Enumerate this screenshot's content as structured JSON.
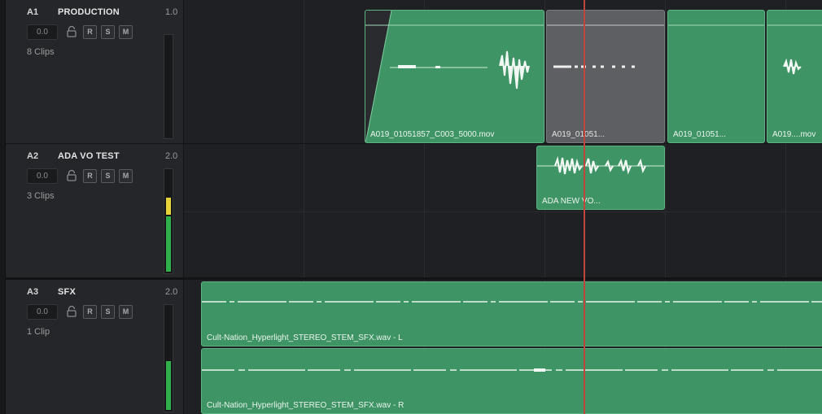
{
  "tracks": [
    {
      "id": "A1",
      "name": "PRODUCTION",
      "level": "1.0",
      "volume": "0.0",
      "clips": "8 Clips"
    },
    {
      "id": "A2",
      "name": "ADA VO TEST",
      "level": "2.0",
      "volume": "0.0",
      "clips": "3 Clips"
    },
    {
      "id": "A3",
      "name": "SFX",
      "level": "2.0",
      "volume": "0.0",
      "clips": "1 Clip"
    }
  ],
  "buttons": {
    "record": "R",
    "solo": "S",
    "mute": "M"
  },
  "clips": {
    "a1": [
      "A019_01051857_C003_5000.mov",
      "A019_01051...",
      "A019_01051...",
      "A019....mov"
    ],
    "a2": [
      "ADA NEW VO..."
    ],
    "a3": [
      "Cult-Nation_Hyperlight_STEREO_STEM_SFX.wav - L",
      "Cult-Nation_Hyperlight_STEREO_STEM_SFX.wav - R"
    ]
  },
  "meters": {
    "a1": {
      "green": 0,
      "yellow": 0
    },
    "a2": {
      "green": 0.55,
      "yellow": 0.17
    },
    "a3": {
      "green": 0.47,
      "yellow": 0
    }
  },
  "colors": {
    "clip": "#3f9465",
    "clip_grey": "#5e5f62",
    "playhead": "#c2453c",
    "meter_green": "#2fb04a",
    "meter_yellow": "#e8d43a"
  }
}
